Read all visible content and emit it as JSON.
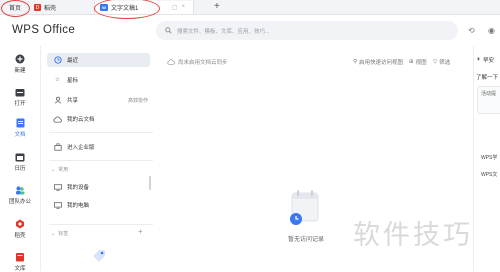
{
  "tabs": [
    {
      "label": "首页"
    },
    {
      "label": "稻壳"
    },
    {
      "label": "文字文稿1"
    }
  ],
  "brand": "WPS Office",
  "search": {
    "placeholder": "搜索文件、模板、文库、应用、技巧..."
  },
  "rail": [
    {
      "label": "新建",
      "icon": "plus-circle-icon"
    },
    {
      "label": "打开",
      "icon": "folder-icon"
    },
    {
      "label": "文档",
      "icon": "document-icon"
    },
    {
      "label": "日历",
      "icon": "calendar-icon"
    },
    {
      "label": "团队办公",
      "icon": "team-icon"
    },
    {
      "label": "稻壳",
      "icon": "daoke-icon"
    },
    {
      "label": "文库",
      "icon": "library-icon"
    }
  ],
  "nav": {
    "items": [
      {
        "label": "最近",
        "icon": "clock-icon"
      },
      {
        "label": "星标",
        "icon": "star-icon"
      },
      {
        "label": "共享",
        "icon": "share-icon",
        "extra": "高效协作"
      },
      {
        "label": "我的云文档",
        "icon": "cloud-icon"
      }
    ],
    "enterprise": "进入企业版",
    "common_section": "常用",
    "common_items": [
      {
        "label": "我的设备"
      },
      {
        "label": "我的电脑"
      }
    ],
    "tags_section": "标签"
  },
  "main": {
    "cloud_tip": "尚未启用文档云同步",
    "quick_access": "启用快速访问视图",
    "view": "视图",
    "filter": "筛选",
    "empty": "暂无访问记录"
  },
  "right_panel": {
    "title": "早安",
    "subtitle": "了解一下",
    "box": "活动提",
    "item1": "WPS学",
    "item2": "WPS文"
  },
  "watermark": "软件技巧",
  "colors": {
    "accent": "#3a78f2",
    "annotation": "#e24640",
    "daoke": "#e2362a"
  }
}
